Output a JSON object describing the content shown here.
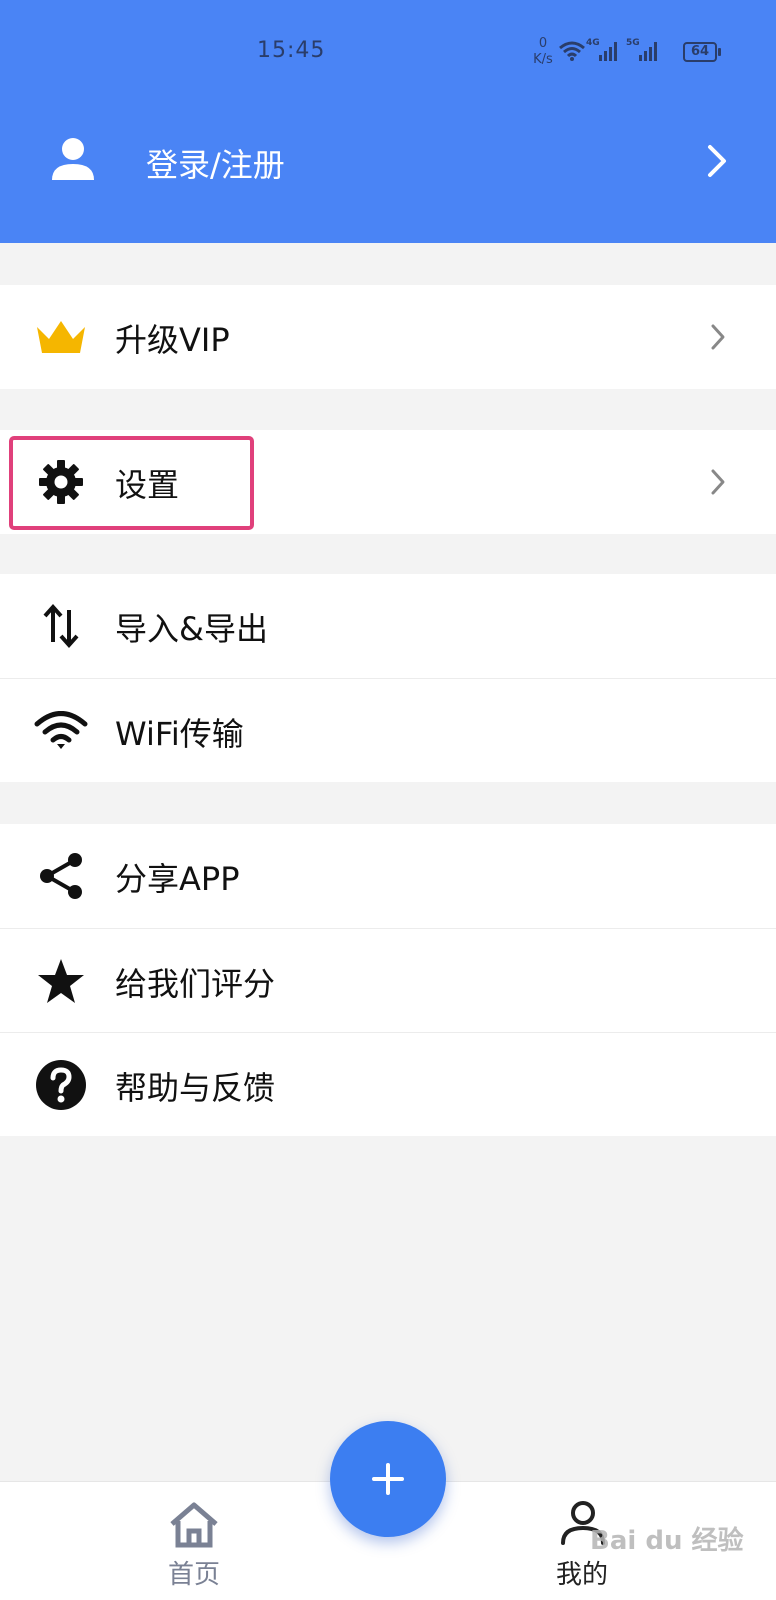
{
  "status_bar": {
    "time": "15:45",
    "net_speed_value": "0",
    "net_speed_unit": "K/s",
    "signal1_label": "4G",
    "signal2_label": "5G",
    "battery": "64"
  },
  "header": {
    "login_label": "登录/注册",
    "icons": {
      "avatar": "person-icon",
      "chevron": "chevron-right-icon"
    },
    "background_color": "#4a84f5"
  },
  "menu": {
    "vip": {
      "label": "升级VIP",
      "icon": "crown-icon",
      "icon_color": "#f5b600"
    },
    "settings": {
      "label": "设置",
      "icon": "gear-icon",
      "highlight_color": "#e0407b"
    },
    "import_export": {
      "label": "导入&导出",
      "icon": "swap-vertical-icon"
    },
    "wifi": {
      "label": "WiFi传输",
      "icon": "wifi-icon"
    },
    "share": {
      "label": "分享APP",
      "icon": "share-icon"
    },
    "rate": {
      "label": "给我们评分",
      "icon": "star-icon"
    },
    "help": {
      "label": "帮助与反馈",
      "icon": "help-icon"
    }
  },
  "bottom_nav": {
    "home": {
      "label": "首页",
      "icon": "home-icon"
    },
    "mine": {
      "label": "我的",
      "icon": "person-outline-icon"
    },
    "fab": {
      "icon": "plus-icon",
      "color": "#3c7ef1"
    }
  },
  "watermark": "Bai du 经验"
}
